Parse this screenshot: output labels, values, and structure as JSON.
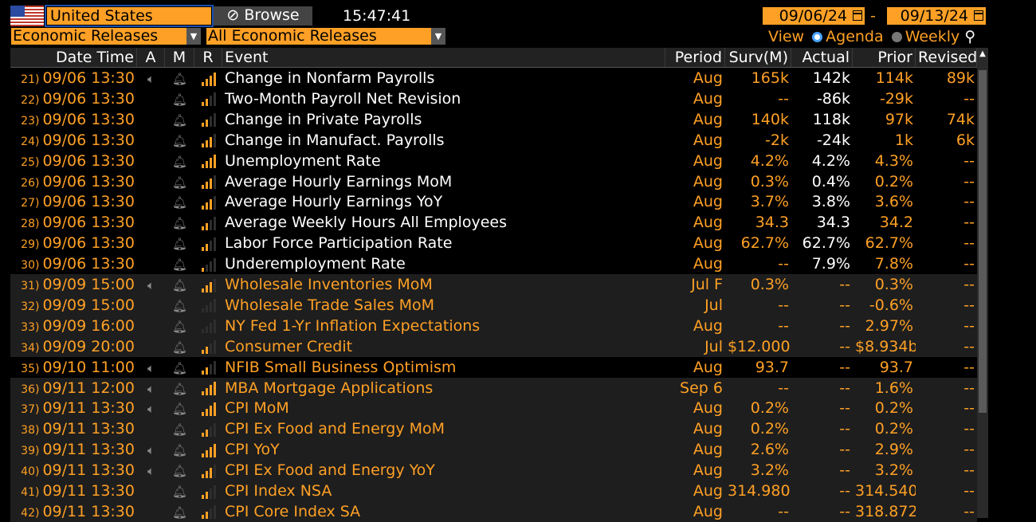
{
  "header": {
    "country": "United States",
    "browse_label": "Browse",
    "clock": "15:47:41",
    "date_from": "09/06/24",
    "date_sep": "-",
    "date_to": "09/13/24",
    "release_type": "Economic Releases",
    "release_filter": "All Economic Releases",
    "view_label": "View",
    "agenda_label": "Agenda",
    "weekly_label": "Weekly"
  },
  "columns": [
    "Date Time",
    "A",
    "M",
    "R",
    "Event",
    "Period",
    "Surv(M)",
    "Actual",
    "Prior",
    "Revised"
  ],
  "rows": [
    {
      "num": "21)",
      "dt": "09/06 13:30",
      "alert": true,
      "rel": 4,
      "event": "Change in Nonfarm Payrolls",
      "period": "Aug",
      "surv": "165k",
      "actual": "142k",
      "prior": "114k",
      "revised": "89k",
      "hl": false,
      "past": true
    },
    {
      "num": "22)",
      "dt": "09/06 13:30",
      "alert": false,
      "rel": 2,
      "event": "Two-Month Payroll Net Revision",
      "period": "Aug",
      "surv": "--",
      "actual": "-86k",
      "prior": "-29k",
      "revised": "--",
      "hl": false,
      "past": true
    },
    {
      "num": "23)",
      "dt": "09/06 13:30",
      "alert": false,
      "rel": 2,
      "event": "Change in Private Payrolls",
      "period": "Aug",
      "surv": "140k",
      "actual": "118k",
      "prior": "97k",
      "revised": "74k",
      "hl": false,
      "past": true
    },
    {
      "num": "24)",
      "dt": "09/06 13:30",
      "alert": false,
      "rel": 3,
      "event": "Change in Manufact. Payrolls",
      "period": "Aug",
      "surv": "-2k",
      "actual": "-24k",
      "prior": "1k",
      "revised": "6k",
      "hl": false,
      "past": true
    },
    {
      "num": "25)",
      "dt": "09/06 13:30",
      "alert": false,
      "rel": 4,
      "event": "Unemployment Rate",
      "period": "Aug",
      "surv": "4.2%",
      "actual": "4.2%",
      "prior": "4.3%",
      "revised": "--",
      "hl": false,
      "past": true
    },
    {
      "num": "26)",
      "dt": "09/06 13:30",
      "alert": false,
      "rel": 3,
      "event": "Average Hourly Earnings MoM",
      "period": "Aug",
      "surv": "0.3%",
      "actual": "0.4%",
      "prior": "0.2%",
      "revised": "--",
      "hl": false,
      "past": true
    },
    {
      "num": "27)",
      "dt": "09/06 13:30",
      "alert": false,
      "rel": 3,
      "event": "Average Hourly Earnings YoY",
      "period": "Aug",
      "surv": "3.7%",
      "actual": "3.8%",
      "prior": "3.6%",
      "revised": "--",
      "hl": false,
      "past": true
    },
    {
      "num": "28)",
      "dt": "09/06 13:30",
      "alert": false,
      "rel": 2,
      "event": "Average Weekly Hours All Employees",
      "period": "Aug",
      "surv": "34.3",
      "actual": "34.3",
      "prior": "34.2",
      "revised": "--",
      "hl": false,
      "past": true
    },
    {
      "num": "29)",
      "dt": "09/06 13:30",
      "alert": false,
      "rel": 2,
      "event": "Labor Force Participation Rate",
      "period": "Aug",
      "surv": "62.7%",
      "actual": "62.7%",
      "prior": "62.7%",
      "revised": "--",
      "hl": false,
      "past": true
    },
    {
      "num": "30)",
      "dt": "09/06 13:30",
      "alert": false,
      "rel": 1,
      "event": "Underemployment Rate",
      "period": "Aug",
      "surv": "--",
      "actual": "7.9%",
      "prior": "7.8%",
      "revised": "--",
      "hl": false,
      "past": true
    },
    {
      "num": "31)",
      "dt": "09/09 15:00",
      "alert": true,
      "rel": 3,
      "event": "Wholesale Inventories MoM",
      "period": "Jul F",
      "surv": "0.3%",
      "actual": "--",
      "prior": "0.3%",
      "revised": "--",
      "hl": true,
      "past": false
    },
    {
      "num": "32)",
      "dt": "09/09 15:00",
      "alert": false,
      "rel": 0,
      "event": "Wholesale Trade Sales MoM",
      "period": "Jul",
      "surv": "--",
      "actual": "--",
      "prior": "-0.6%",
      "revised": "--",
      "hl": true,
      "past": false
    },
    {
      "num": "33)",
      "dt": "09/09 16:00",
      "alert": false,
      "rel": 0,
      "event": "NY Fed 1-Yr Inflation Expectations",
      "period": "Aug",
      "surv": "--",
      "actual": "--",
      "prior": "2.97%",
      "revised": "--",
      "hl": true,
      "past": false
    },
    {
      "num": "34)",
      "dt": "09/09 20:00",
      "alert": false,
      "rel": 2,
      "event": "Consumer Credit",
      "period": "Jul",
      "surv": "$12.000b",
      "actual": "--",
      "prior": "$8.934b",
      "revised": "--",
      "hl": true,
      "past": false
    },
    {
      "num": "35)",
      "dt": "09/10 11:00",
      "alert": true,
      "rel": 2,
      "event": "NFIB Small Business Optimism",
      "period": "Aug",
      "surv": "93.7",
      "actual": "--",
      "prior": "93.7",
      "revised": "--",
      "hl": false,
      "past": false
    },
    {
      "num": "36)",
      "dt": "09/11 12:00",
      "alert": true,
      "rel": 4,
      "event": "MBA Mortgage Applications",
      "period": "Sep 6",
      "surv": "--",
      "actual": "--",
      "prior": "1.6%",
      "revised": "--",
      "hl": true,
      "past": false
    },
    {
      "num": "37)",
      "dt": "09/11 13:30",
      "alert": true,
      "rel": 4,
      "event": "CPI MoM",
      "period": "Aug",
      "surv": "0.2%",
      "actual": "--",
      "prior": "0.2%",
      "revised": "--",
      "hl": true,
      "past": false
    },
    {
      "num": "38)",
      "dt": "09/11 13:30",
      "alert": false,
      "rel": 2,
      "event": "CPI Ex Food and Energy MoM",
      "period": "Aug",
      "surv": "0.2%",
      "actual": "--",
      "prior": "0.2%",
      "revised": "--",
      "hl": true,
      "past": false
    },
    {
      "num": "39)",
      "dt": "09/11 13:30",
      "alert": true,
      "rel": 4,
      "event": "CPI YoY",
      "period": "Aug",
      "surv": "2.6%",
      "actual": "--",
      "prior": "2.9%",
      "revised": "--",
      "hl": true,
      "past": false
    },
    {
      "num": "40)",
      "dt": "09/11 13:30",
      "alert": true,
      "rel": 3,
      "event": "CPI Ex Food and Energy YoY",
      "period": "Aug",
      "surv": "3.2%",
      "actual": "--",
      "prior": "3.2%",
      "revised": "--",
      "hl": true,
      "past": false
    },
    {
      "num": "41)",
      "dt": "09/11 13:30",
      "alert": false,
      "rel": 2,
      "event": "CPI Index NSA",
      "period": "Aug",
      "surv": "314.980",
      "actual": "--",
      "prior": "314.540",
      "revised": "--",
      "hl": true,
      "past": false
    },
    {
      "num": "42)",
      "dt": "09/11 13:30",
      "alert": false,
      "rel": 2,
      "event": "CPI Core Index SA",
      "period": "Aug",
      "surv": "--",
      "actual": "--",
      "prior": "318.872",
      "revised": "--",
      "hl": true,
      "past": false
    }
  ],
  "colors": {
    "orange": "#fea025",
    "white": "#ffffff",
    "hl_bg": "#1e1e1e",
    "row_bg": "#000000",
    "icon": "#8a8a8a"
  }
}
